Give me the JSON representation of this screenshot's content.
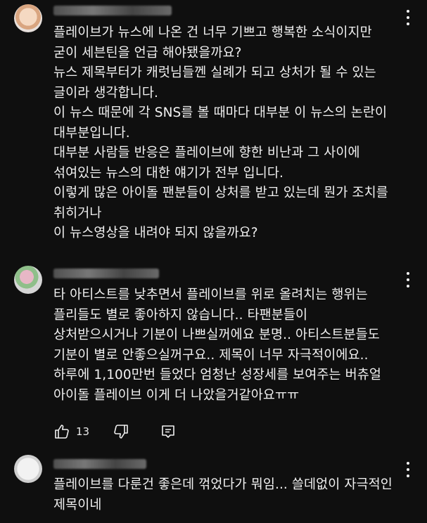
{
  "comments": [
    {
      "text": "플레이브가 뉴스에 나온 건 너무 기쁘고 행복한 소식이지만\n굳이 세븐틴을 언급 해야됐을까요?\n뉴스 제목부터가 캐럿님들껜 실례가 되고 상처가 될 수 있는\n글이라 생각합니다.\n이 뉴스 때문에 각 SNS를 볼 때마다 대부분 이 뉴스의 논란이\n대부분입니다.\n대부분 사람들 반응은 플레이브에 향한 비난과 그 사이에\n섞여있는 뉴스의 대한 얘기가 전부 입니다.\n이렇게 많은 아이돌 팬분들이 상처를 받고 있는데 뭔가 조치를\n취히거나\n이 뉴스영상을 내려야 되지 않을까요?"
    },
    {
      "text": "타 아티스트를 낮추면서 플레이브를 위로 올려치는 행위는\n플리들도 별로 좋아하지 않습니다.. 타팬분들이\n상처받으시거나 기분이 나쁘실꺼에요 분명.. 아티스트분들도\n기분이 별로 안좋으실꺼구요.. 제목이 너무 자극적이에요..\n하루에 1,100만번 들었다 엄청난 성장세를 보여주는 버츄얼\n아이돌 플레이브 이게 더 나았을거같아요ㅠㅠ",
      "like_count": "13"
    },
    {
      "text": "플레이브를 다룬건 좋은데 꺾었다가 뭐임... 쓸데없이 자극적인\n제목이네"
    }
  ]
}
